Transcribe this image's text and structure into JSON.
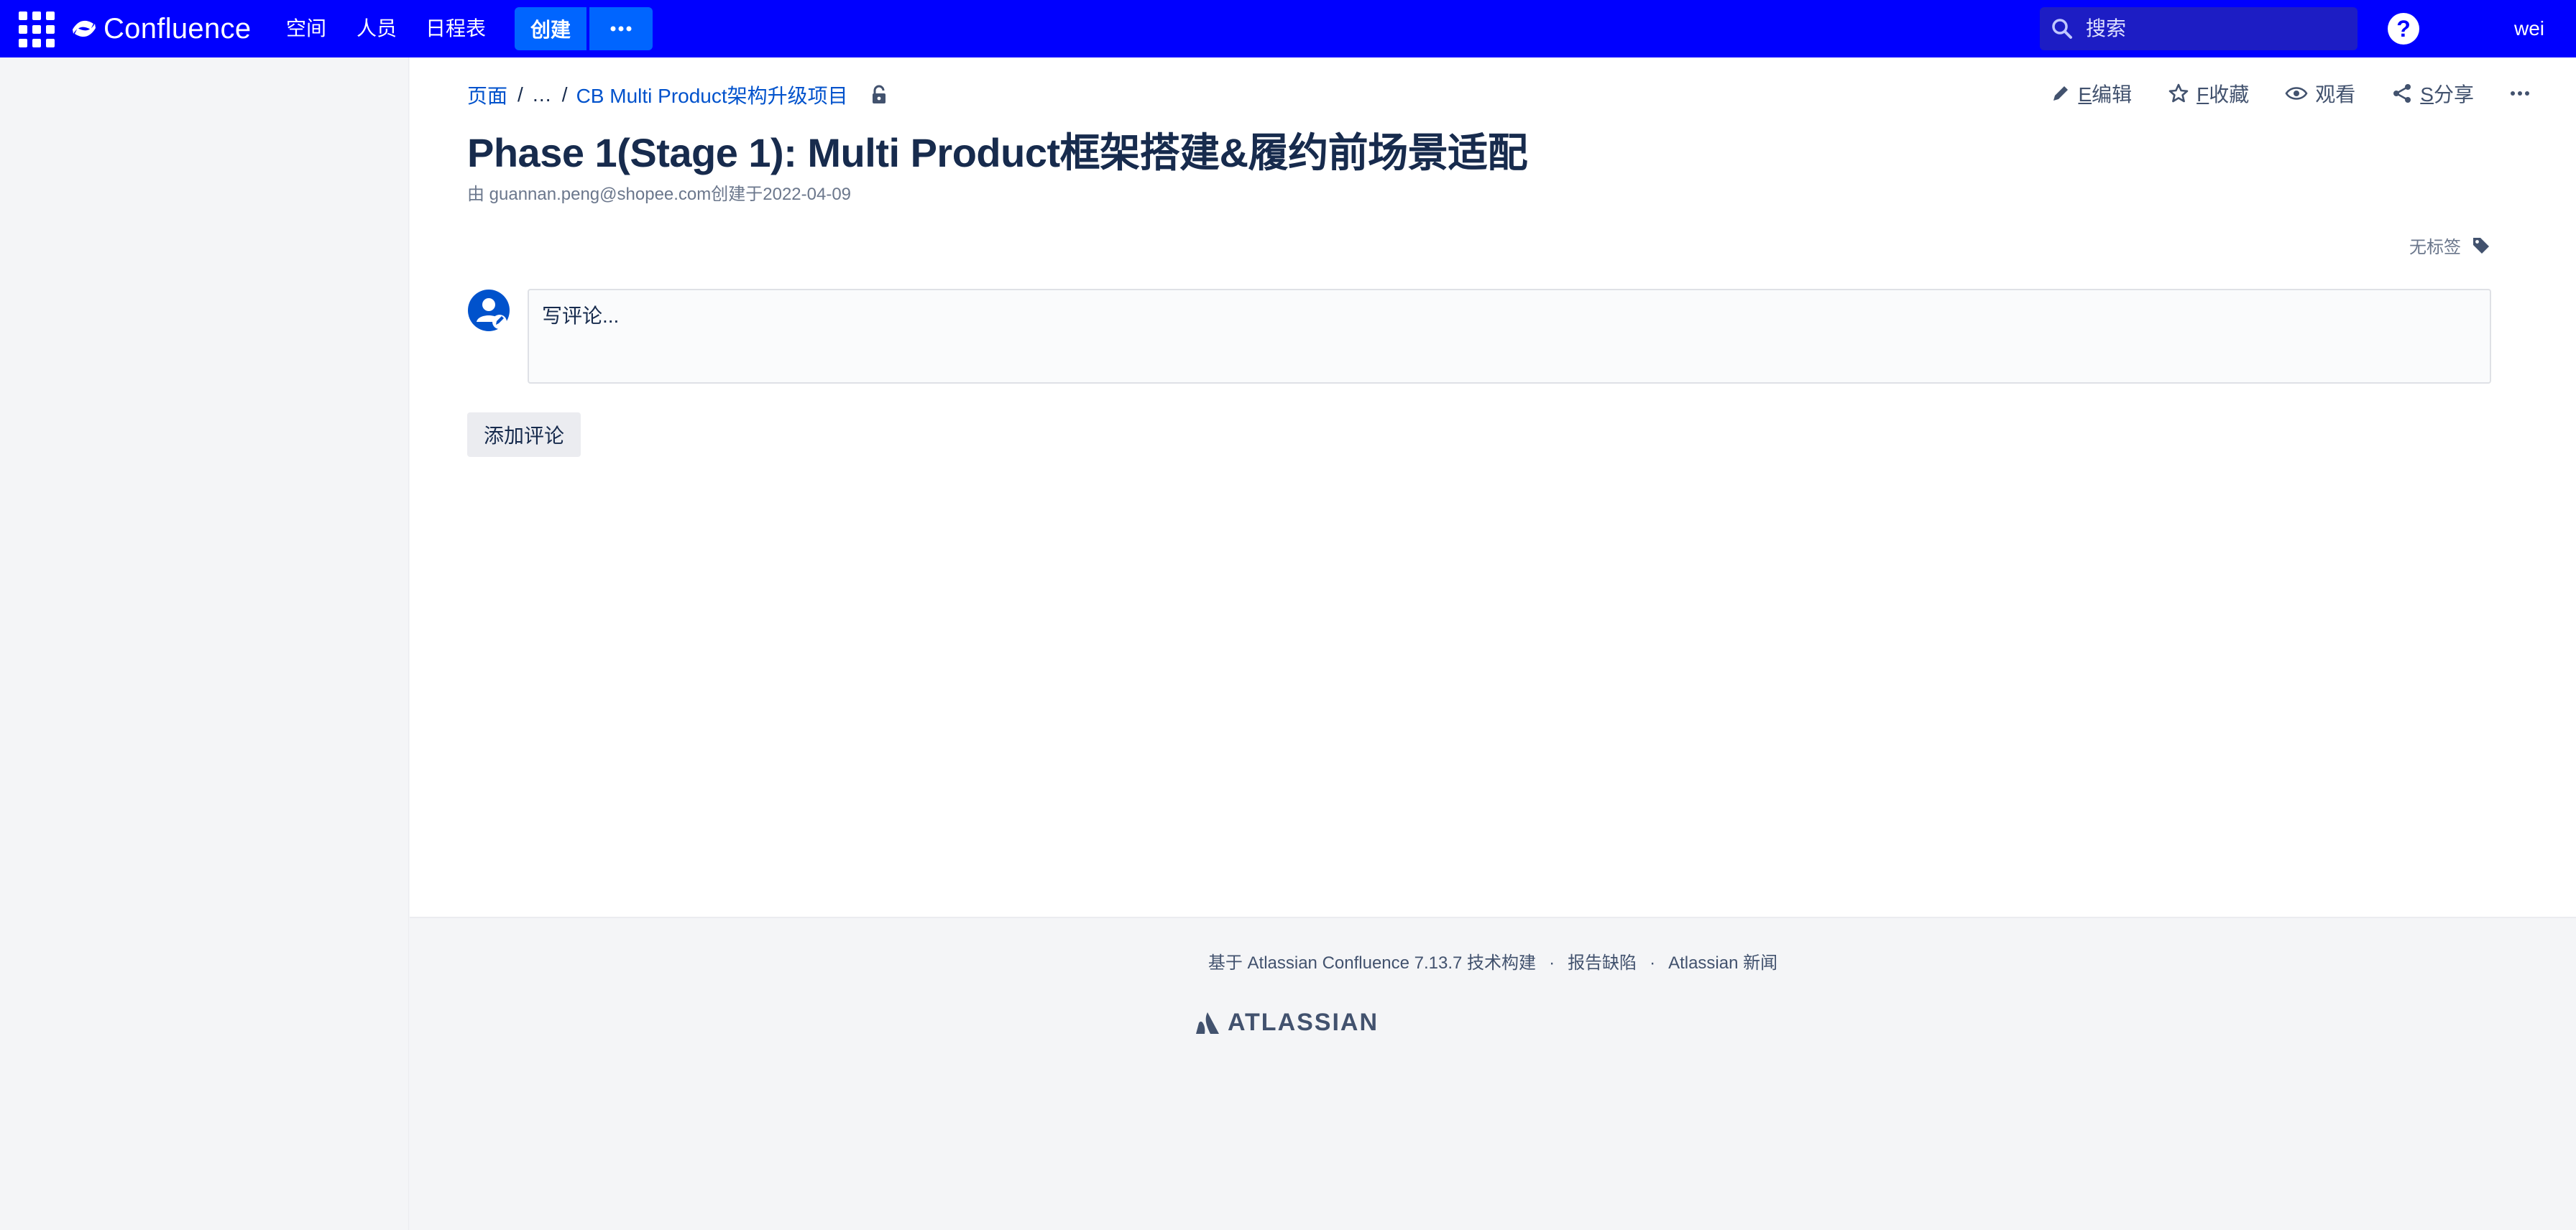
{
  "topbar": {
    "app_name": "Confluence",
    "nav": [
      "空间",
      "人员",
      "日程表"
    ],
    "create_label": "创建",
    "more_label": "···",
    "search_placeholder": "搜索",
    "help_label": "?",
    "user_name": "wei",
    "bg_color": "#0000ff"
  },
  "breadcrumb": {
    "items": [
      "页面",
      "…",
      "CB Multi Product架构升级项目"
    ]
  },
  "actions": {
    "edit": {
      "key": "E",
      "label": "编辑"
    },
    "favorite": {
      "key": "F",
      "label": "收藏"
    },
    "watch": {
      "label": "观看"
    },
    "share": {
      "key": "S",
      "label": "分享"
    },
    "more": "···"
  },
  "page": {
    "title": "Phase 1(Stage 1): Multi Product框架搭建&履约前场景适配",
    "byline": "由 guannan.peng@shopee.com创建于2022-04-09",
    "labels_text": "无标签"
  },
  "comments": {
    "placeholder": "写评论...",
    "add_button": "添加评论"
  },
  "footer": {
    "powered_by": "基于 Atlassian Confluence 7.13.7 技术构建",
    "report_bug": "报告缺陷",
    "news": "Atlassian 新闻",
    "separator": "·",
    "logo_text": "ATLASSIAN"
  },
  "colors": {
    "link": "#0052cc",
    "text": "#172b4d",
    "muted": "#6b778c",
    "create_button": "#0065ff"
  }
}
